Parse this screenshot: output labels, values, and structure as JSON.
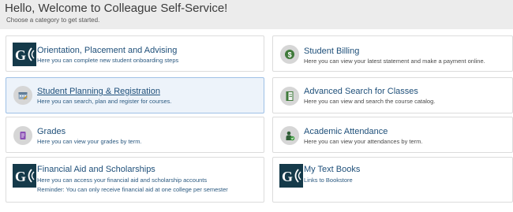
{
  "header": {
    "title": "Hello, Welcome to Colleague Self-Service!",
    "subtitle": "Choose a category to get started."
  },
  "cards": [
    {
      "title": "Orientation, Placement and Advising",
      "description": "Here you can complete new student onboarding steps",
      "icon": "gc-logo-icon",
      "selected": false
    },
    {
      "title": "Student Billing",
      "description": "Here you can view your latest statement and make a payment online.",
      "icon": "money-icon",
      "selected": false
    },
    {
      "title": "Student Planning & Registration",
      "description": "Here you can search, plan and register for courses.",
      "icon": "calendar-icon",
      "selected": true
    },
    {
      "title": "Advanced Search for Classes",
      "description": "Here you can view and search the course catalog.",
      "icon": "catalog-icon",
      "selected": false
    },
    {
      "title": "Grades",
      "description": "Here you can view your grades by term.",
      "icon": "grades-icon",
      "selected": false
    },
    {
      "title": "Academic Attendance",
      "description": "Here you can view your attendances by term.",
      "icon": "attendance-icon",
      "selected": false
    },
    {
      "title": "Financial Aid and Scholarships",
      "description": "Here you can access your financial aid and scholarship accounts",
      "description_line2": "Reminder: You can only receive financial aid at one college per semester",
      "icon": "gc-logo-icon",
      "selected": false
    },
    {
      "title": "My Text Books",
      "description": "Links to Bookstore",
      "icon": "gc-logo-icon",
      "selected": false
    }
  ],
  "logo": {
    "text": "G"
  },
  "colors": {
    "accent": "#1e4f79",
    "logo_bg": "#153a4a",
    "icon_green": "#3f7a3a",
    "icon_purple": "#8a4fb5",
    "selected_bg": "#edf3fa"
  }
}
